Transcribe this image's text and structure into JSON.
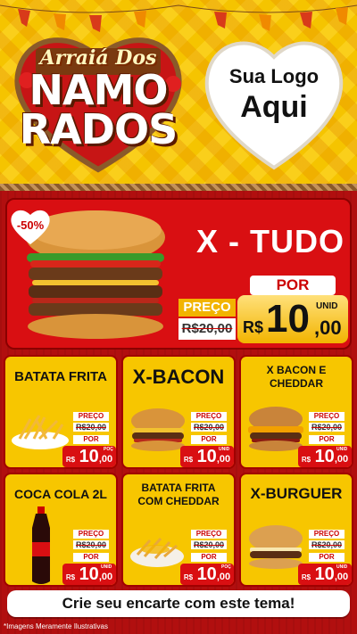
{
  "header": {
    "event_title_line1": "Arraiá Dos",
    "event_title_line2": "NAMO",
    "event_title_line3": "RADOS",
    "logo_line1": "Sua Logo",
    "logo_line2": "Aqui"
  },
  "featured": {
    "discount": "-50%",
    "name": "X - TUDO",
    "preco_label": "PREÇO",
    "old_price": "R$20,00",
    "por_label": "POR",
    "unit": "UNID",
    "currency": "R$",
    "price_int": "10",
    "price_dec": ",00"
  },
  "products": [
    {
      "name": "BATATA FRITA",
      "preco_label": "PREÇO",
      "old_price": "R$20,00",
      "por_label": "POR",
      "currency": "R$",
      "price_int": "10",
      "price_dec": ",00",
      "unit": "POÇ"
    },
    {
      "name": "X-BACON",
      "preco_label": "PREÇO",
      "old_price": "R$20,00",
      "por_label": "POR",
      "currency": "R$",
      "price_int": "10",
      "price_dec": ",00",
      "unit": "UNID"
    },
    {
      "name": "X BACON E CHEDDAR",
      "preco_label": "PREÇO",
      "old_price": "R$20,00",
      "por_label": "POR",
      "currency": "R$",
      "price_int": "10",
      "price_dec": ",00",
      "unit": "UNID"
    },
    {
      "name": "COCA COLA 2L",
      "preco_label": "PREÇO",
      "old_price": "R$20,00",
      "por_label": "POR",
      "currency": "R$",
      "price_int": "10",
      "price_dec": ",00",
      "unit": "UNID"
    },
    {
      "name": "BATATA FRITA COM CHEDDAR",
      "preco_label": "PREÇO",
      "old_price": "R$20,00",
      "por_label": "POR",
      "currency": "R$",
      "price_int": "10",
      "price_dec": ",00",
      "unit": "POÇ"
    },
    {
      "name": "X-BURGUER",
      "preco_label": "PREÇO",
      "old_price": "R$20,00",
      "por_label": "POR",
      "currency": "R$",
      "price_int": "10",
      "price_dec": ",00",
      "unit": "UNID"
    }
  ],
  "cta": "Crie seu encarte com este tema!",
  "disclaimer": "*Imagens Meramente Ilustrativas",
  "colors": {
    "red": "#d90f12",
    "yellow": "#f7c600",
    "gold": "#f2b400"
  }
}
